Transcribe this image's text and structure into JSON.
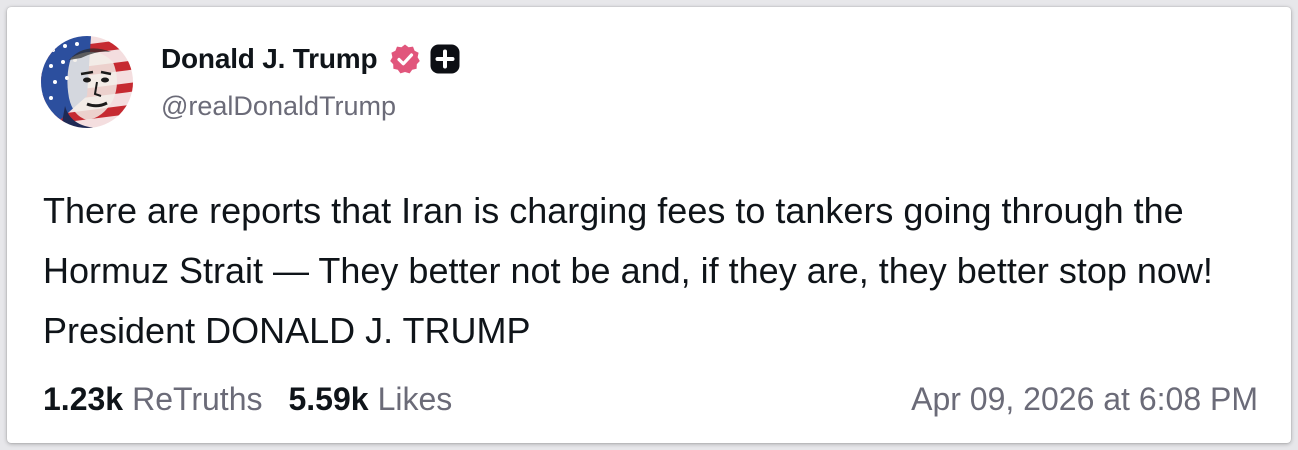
{
  "post": {
    "author": {
      "display_name": "Donald J. Trump",
      "handle": "@realDonaldTrump",
      "verified_icon": "verified-badge-icon",
      "plus_icon": "plus-badge-icon",
      "verified_color": "#e1567c"
    },
    "text": "There are reports that Iran is charging fees to tankers going through the Hormuz Strait — They better not be and, if they are, they better stop now! President DONALD J. TRUMP",
    "stats": {
      "retruths_count": "1.23k",
      "retruths_label": "ReTruths",
      "likes_count": "5.59k",
      "likes_label": "Likes"
    },
    "timestamp": "Apr 09, 2026 at 6:08 PM"
  }
}
